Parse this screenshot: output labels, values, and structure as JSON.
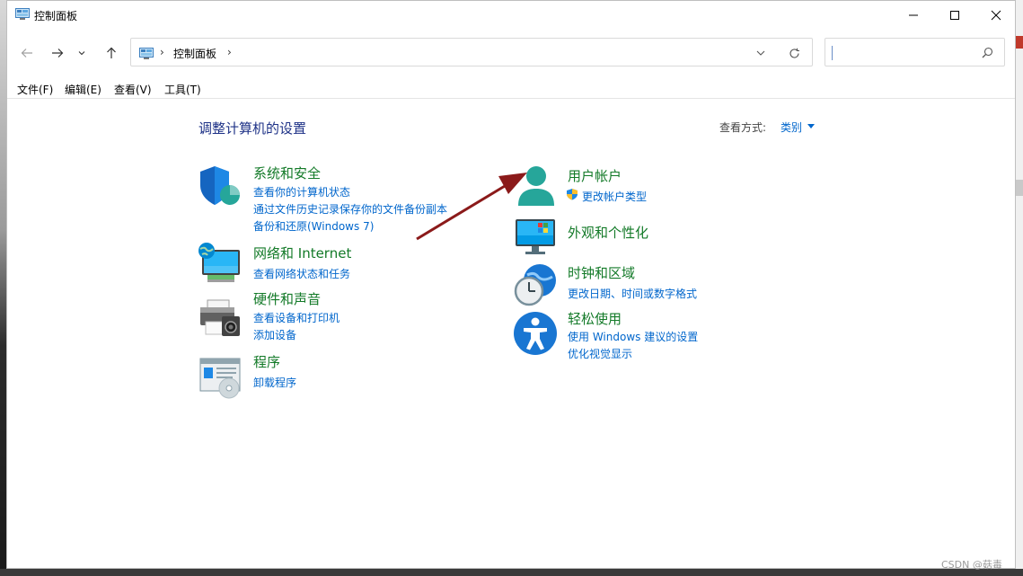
{
  "window": {
    "title": "控制面板"
  },
  "address": {
    "path_item": "控制面板",
    "search_placeholder": ""
  },
  "menu": [
    "文件(F)",
    "编辑(E)",
    "查看(V)",
    "工具(T)"
  ],
  "page": {
    "title": "调整计算机的设置",
    "view_by_label": "查看方式:",
    "view_by_value": "类别"
  },
  "categories": {
    "system": {
      "title": "系统和安全",
      "links": [
        "查看你的计算机状态",
        "通过文件历史记录保存你的文件备份副本",
        "备份和还原(Windows 7)"
      ]
    },
    "network": {
      "title": "网络和 Internet",
      "links": [
        "查看网络状态和任务"
      ]
    },
    "hardware": {
      "title": "硬件和声音",
      "links": [
        "查看设备和打印机",
        "添加设备"
      ]
    },
    "programs": {
      "title": "程序",
      "links": [
        "卸载程序"
      ]
    },
    "users": {
      "title": "用户帐户",
      "links": [
        "更改帐户类型"
      ]
    },
    "appearance": {
      "title": "外观和个性化",
      "links": []
    },
    "clock": {
      "title": "时钟和区域",
      "links": [
        "更改日期、时间或数字格式"
      ]
    },
    "ease": {
      "title": "轻松使用",
      "links": [
        "使用 Windows 建议的设置",
        "优化视觉显示"
      ]
    }
  },
  "watermark": "CSDN @菇毒",
  "colors": {
    "category_title": "#137a28",
    "link": "#0066cc",
    "page_title": "#1e3287",
    "annotation_arrow": "#8b1a1a"
  }
}
